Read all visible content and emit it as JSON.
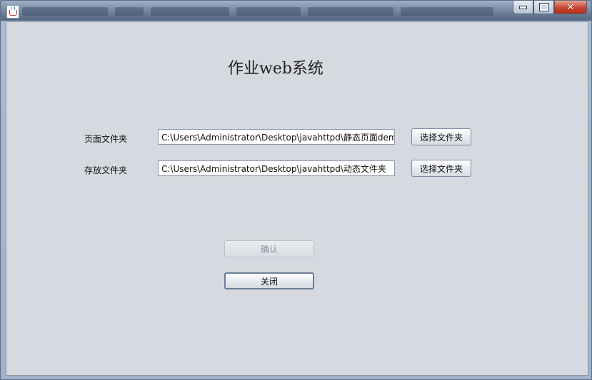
{
  "window": {
    "controls": {
      "minimize_icon": "minimize-icon",
      "maximize_icon": "maximize-icon",
      "close_icon": "close-icon",
      "close_symbol": "✕"
    }
  },
  "form": {
    "heading": "作业web系统",
    "page_folder": {
      "label": "页面文件夹",
      "value": "C:\\Users\\Administrator\\Desktop\\javahttpd\\静态页面demo",
      "button": "选择文件夹"
    },
    "store_folder": {
      "label": "存放文件夹",
      "value": "C:\\Users\\Administrator\\Desktop\\javahttpd\\动态文件夹",
      "button": "选择文件夹"
    },
    "confirm_button": "确认",
    "close_button": "关闭"
  }
}
